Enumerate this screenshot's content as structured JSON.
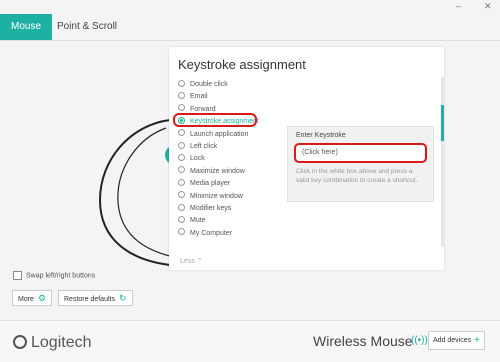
{
  "window": {
    "minimize": "‒",
    "close": "✕"
  },
  "tabs": [
    {
      "label": "Mouse",
      "active": true
    },
    {
      "label": "Point & Scroll",
      "active": false
    }
  ],
  "panel": {
    "title": "Keystroke assignment",
    "options": [
      {
        "label": "Double click",
        "selected": false
      },
      {
        "label": "Email",
        "selected": false
      },
      {
        "label": "Forward",
        "selected": false
      },
      {
        "label": "Keystroke assignment",
        "selected": true
      },
      {
        "label": "Launch application",
        "selected": false
      },
      {
        "label": "Left click",
        "selected": false
      },
      {
        "label": "Lock",
        "selected": false
      },
      {
        "label": "Maximize window",
        "selected": false
      },
      {
        "label": "Media player",
        "selected": false
      },
      {
        "label": "Minimize window",
        "selected": false
      },
      {
        "label": "Modifier keys",
        "selected": false
      },
      {
        "label": "Mute",
        "selected": false
      },
      {
        "label": "My Computer",
        "selected": false
      }
    ],
    "less_label": "Less",
    "less_icon": "chevron-up-icon"
  },
  "keystroke": {
    "title": "Enter Keystroke",
    "input_placeholder": "(Click here)",
    "help": "Click in the white box above and press a valid key combination to create a shortcut."
  },
  "swap_label": "Swap left/right buttons",
  "buttons": {
    "more": "More",
    "restore": "Restore defaults"
  },
  "footer": {
    "brand": "Logitech",
    "device": "Wireless Mouse",
    "add_devices": "Add devices"
  },
  "colors": {
    "accent": "#1fb0a4",
    "highlight": "#d91a1a"
  }
}
